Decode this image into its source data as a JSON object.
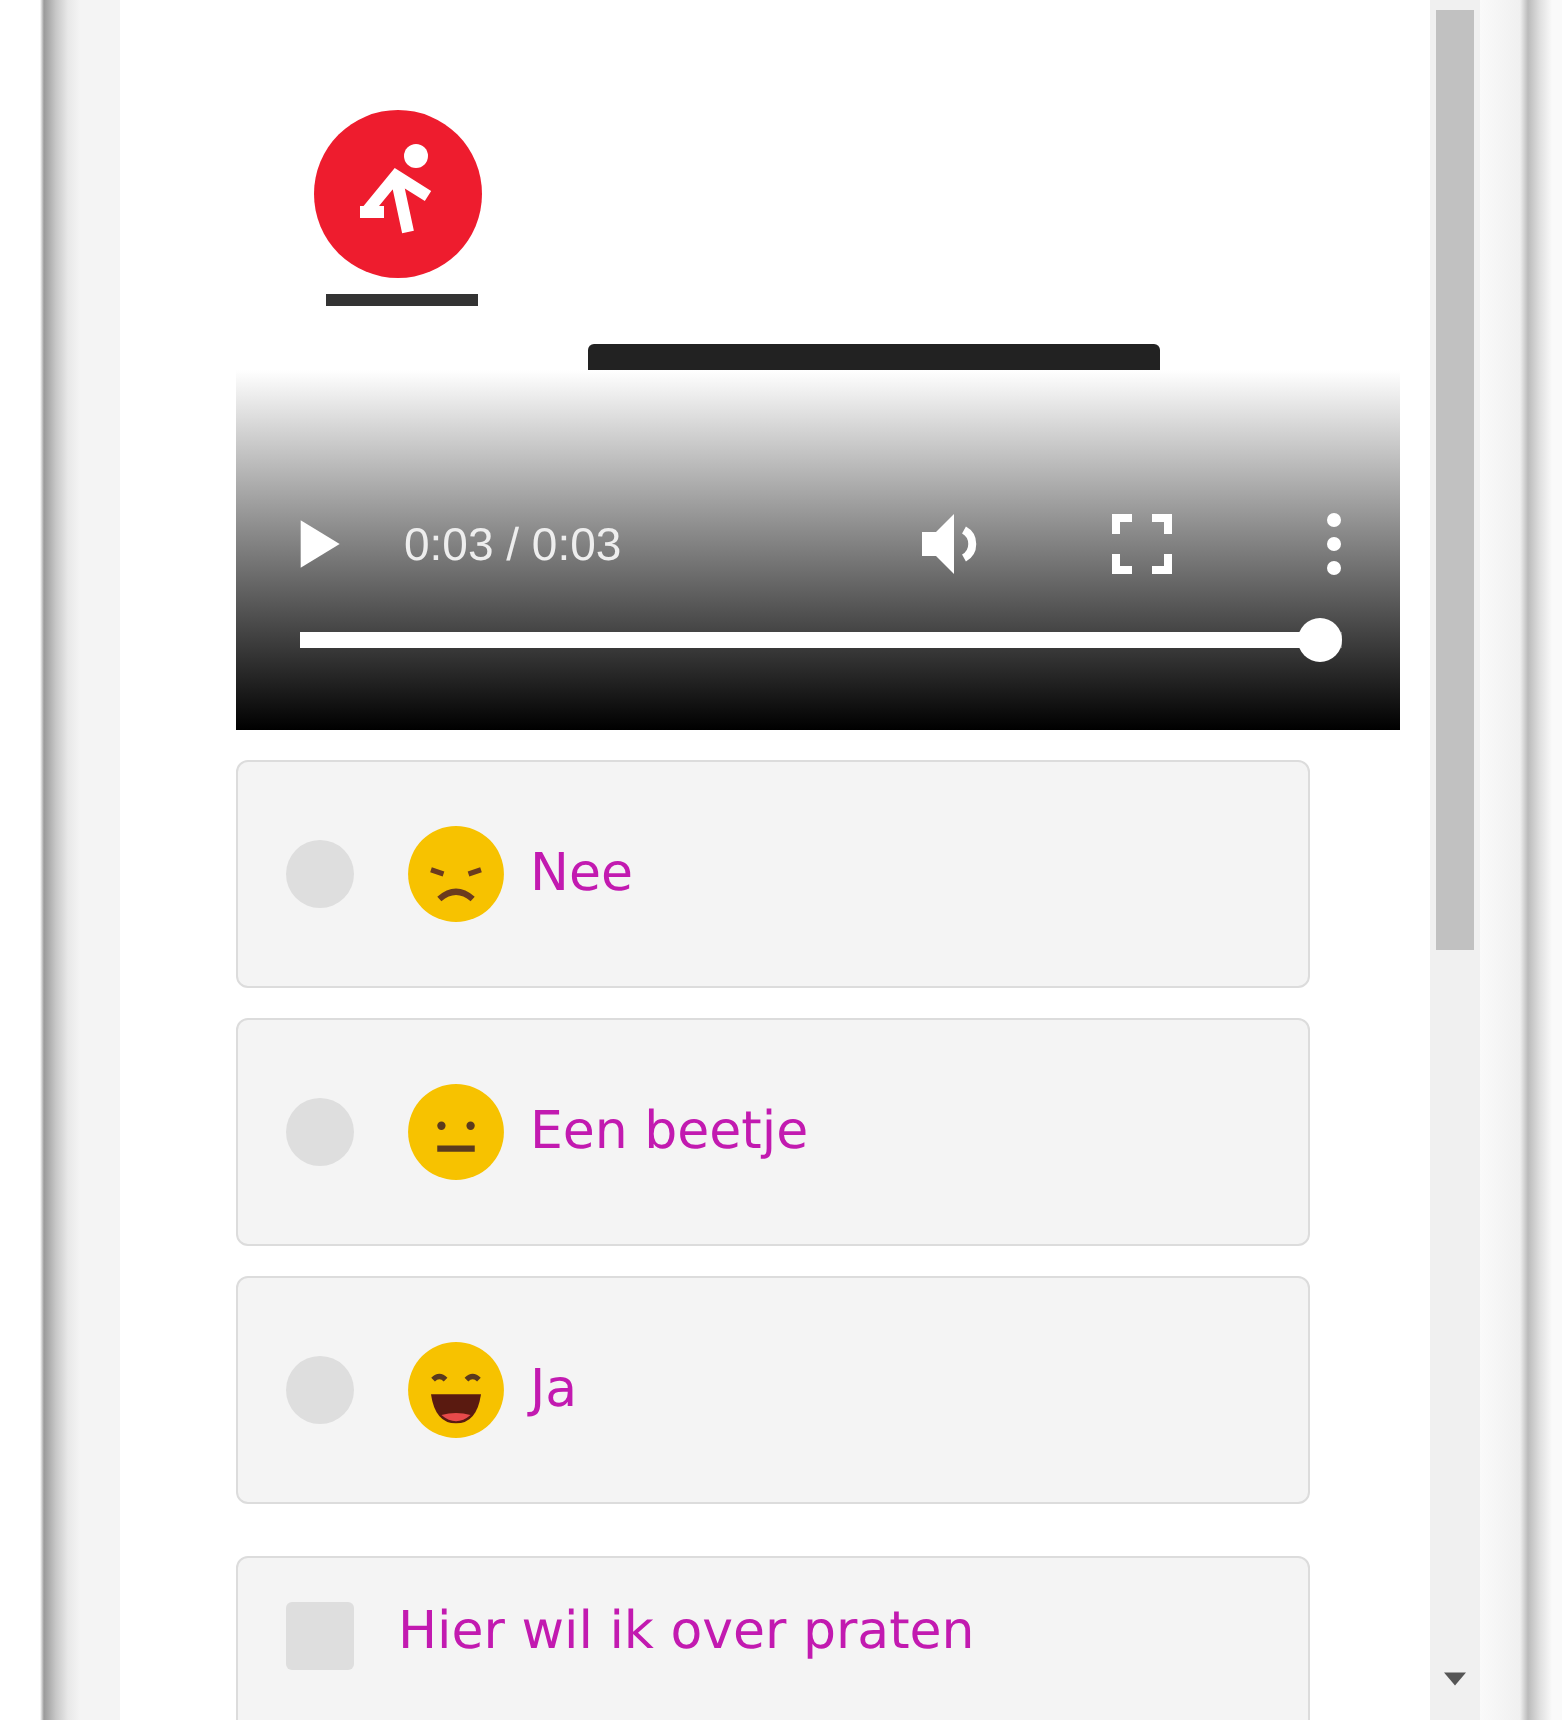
{
  "video": {
    "time": "0:03 / 0:03",
    "level": 1
  },
  "options": [
    {
      "kind": "radio",
      "emoji": {
        "kind": "sad"
      },
      "label": "Nee",
      "selected": false
    },
    {
      "kind": "radio",
      "emoji": {
        "kind": "neutral"
      },
      "label": "Een beetje",
      "selected": false
    },
    {
      "kind": "radio",
      "emoji": {
        "kind": "happy"
      },
      "label": "Ja",
      "selected": false
    },
    {
      "kind": "checkbox",
      "label": "Hier wil ik over praten",
      "checked": false
    }
  ]
}
